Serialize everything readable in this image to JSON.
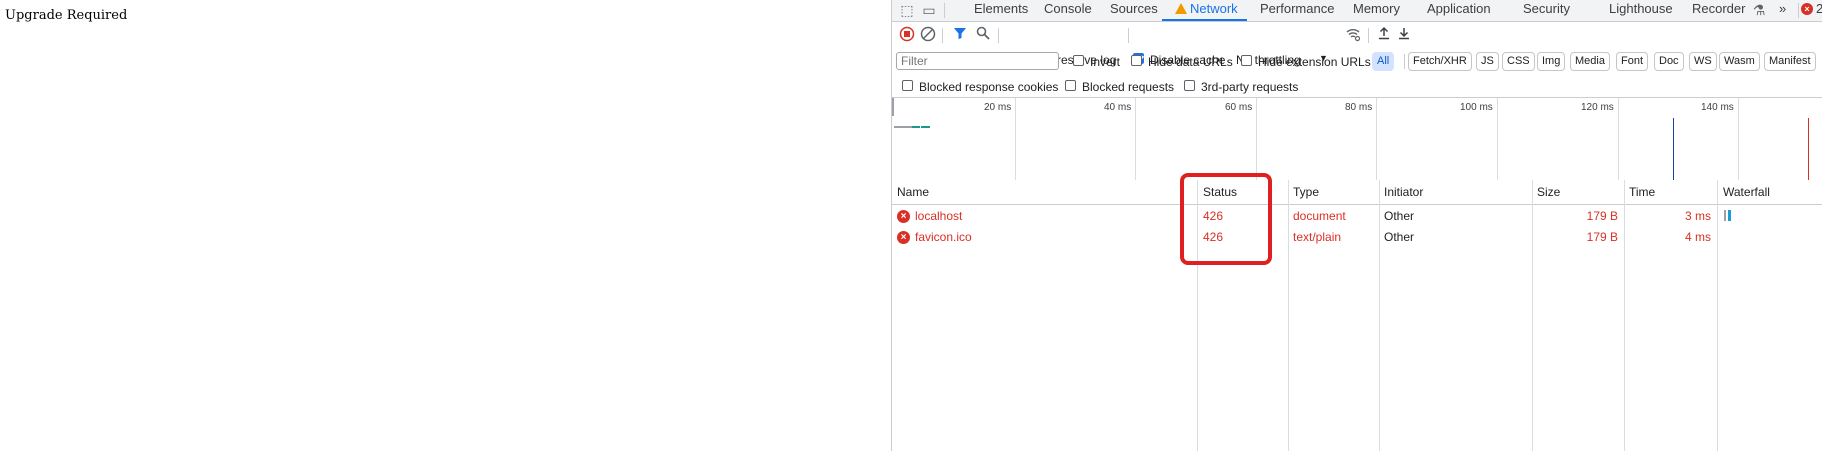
{
  "page": {
    "body_text": "Upgrade Required"
  },
  "devtools": {
    "tabs": [
      {
        "label": "Elements"
      },
      {
        "label": "Console"
      },
      {
        "label": "Sources"
      },
      {
        "label": "Network",
        "active": true,
        "warning": true
      },
      {
        "label": "Performance"
      },
      {
        "label": "Memory"
      },
      {
        "label": "Application"
      },
      {
        "label": "Security"
      },
      {
        "label": "Lighthouse"
      },
      {
        "label": "Recorder"
      }
    ],
    "more_tabs": "»",
    "error_count": "2",
    "toolbar": {
      "preserve_log": {
        "label": "Preserve log",
        "checked": true
      },
      "disable_cache": {
        "label": "Disable cache",
        "checked": true
      },
      "throttling": "No throttling"
    },
    "filter": {
      "placeholder": "Filter",
      "invert": "Invert",
      "hide_data_urls": "Hide data URLs",
      "hide_extension_urls": "Hide extension URLs",
      "chips": [
        "All",
        "Fetch/XHR",
        "JS",
        "CSS",
        "Img",
        "Media",
        "Font",
        "Doc",
        "WS",
        "Wasm",
        "Manifest"
      ]
    },
    "options": {
      "blocked_cookies": "Blocked response cookies",
      "blocked_requests": "Blocked requests",
      "third_party": "3rd-party requests"
    },
    "overview_ticks": [
      "20 ms",
      "40 ms",
      "60 ms",
      "80 ms",
      "100 ms",
      "120 ms",
      "140 ms"
    ],
    "columns": {
      "name": "Name",
      "status": "Status",
      "type": "Type",
      "initiator": "Initiator",
      "size": "Size",
      "time": "Time",
      "waterfall": "Waterfall"
    },
    "requests": [
      {
        "name": "localhost",
        "status": "426",
        "type": "document",
        "initiator": "Other",
        "size": "179 B",
        "time": "3 ms"
      },
      {
        "name": "favicon.ico",
        "status": "426",
        "type": "text/plain",
        "initiator": "Other",
        "size": "179 B",
        "time": "4 ms"
      }
    ],
    "colors": {
      "error": "#d93025",
      "accent": "#1a73e8",
      "highlight": "#e02020"
    }
  }
}
